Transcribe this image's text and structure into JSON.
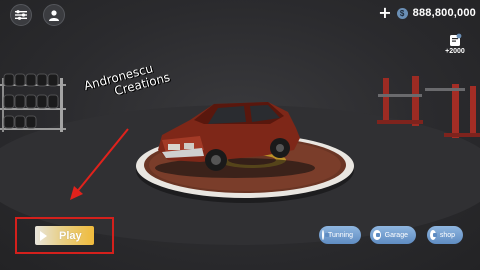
{
  "hud": {
    "menu_icon": "sliders-menu-icon",
    "profile_icon": "user-profile-icon",
    "plus_label": "+",
    "coin_symbol": "$",
    "money": "888,800,000",
    "reward_amount": "+2000",
    "reward_icon": "gift-card-icon"
  },
  "watermark": {
    "line1": "Andronescu",
    "line2": "Creations"
  },
  "actions": {
    "play_label": "Play",
    "tuning_label": "Tunning",
    "garage_label": "Garage",
    "shop_label": "shop"
  },
  "colors": {
    "accent_blue": "#6b8fb5",
    "play_gradient_end": "#f0bb3c",
    "highlight_red": "#d4201c",
    "car_body": "#8a2a1c"
  }
}
